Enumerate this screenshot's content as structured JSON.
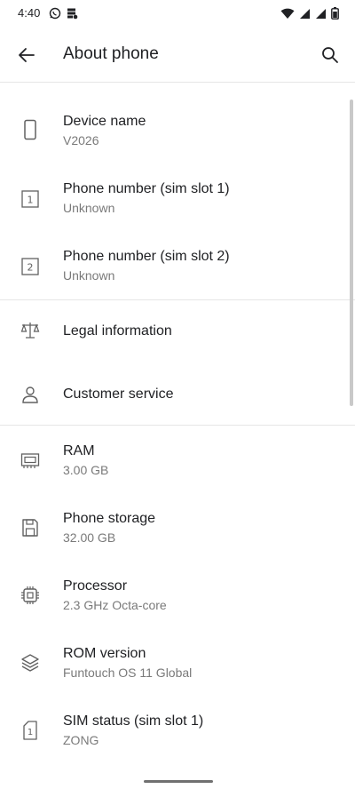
{
  "status_bar": {
    "time": "4:40",
    "left_icons": [
      "whatsapp-icon",
      "storage-icon"
    ],
    "right_icons": [
      "wifi-icon",
      "signal-icon",
      "signal-icon",
      "battery-icon"
    ]
  },
  "header": {
    "title": "About phone"
  },
  "items": [
    {
      "label": "Device name",
      "value": "V2026",
      "icon": "phone-icon"
    },
    {
      "label": "Phone number (sim slot 1)",
      "value": "Unknown",
      "icon": "sim1-icon"
    },
    {
      "label": "Phone number (sim slot 2)",
      "value": "Unknown",
      "icon": "sim2-icon"
    },
    {
      "label": "Legal information",
      "icon": "scale-icon"
    },
    {
      "label": "Customer service",
      "icon": "person-icon"
    },
    {
      "label": "RAM",
      "value": "3.00 GB",
      "icon": "memory-icon"
    },
    {
      "label": "Phone storage",
      "value": "32.00 GB",
      "icon": "save-icon"
    },
    {
      "label": "Processor",
      "value": "2.3 GHz Octa-core",
      "icon": "chip-icon"
    },
    {
      "label": "ROM version",
      "value": "Funtouch OS 11 Global",
      "icon": "layers-icon"
    },
    {
      "label": "SIM status (sim slot 1)",
      "value": "ZONG",
      "icon": "sim-icon"
    }
  ]
}
